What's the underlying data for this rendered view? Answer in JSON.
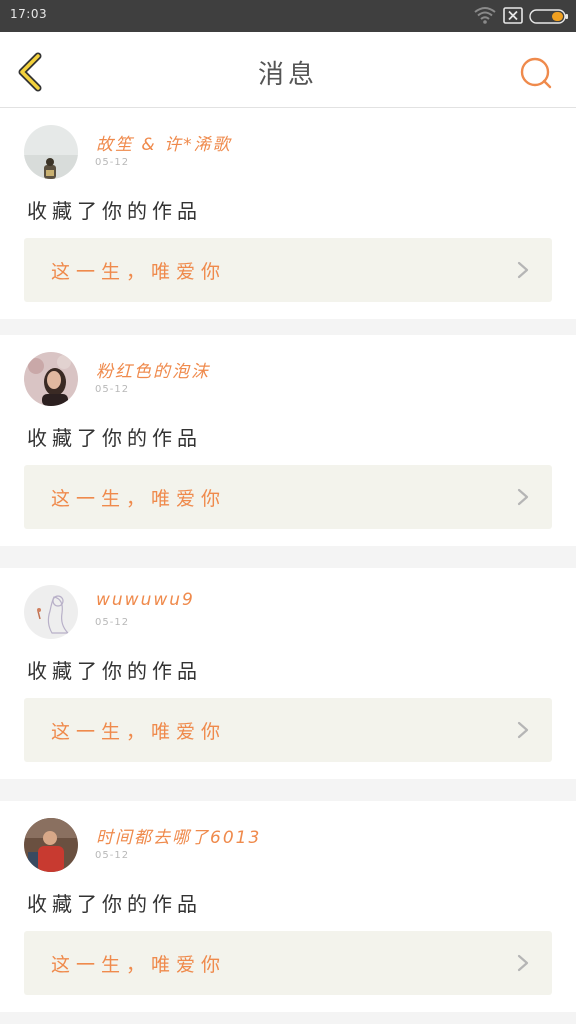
{
  "status_bar": {
    "time": "17:03",
    "icons": [
      "wifi-icon",
      "no-sim-icon",
      "battery-icon"
    ],
    "battery_color": "#f0a020"
  },
  "header": {
    "title": "消息",
    "back_icon": "chevron-left-icon",
    "search_icon": "search-icon",
    "accent_color": "#ef8a4c"
  },
  "notifications": [
    {
      "username": "故笙 & 许*浠歌",
      "date": "05-12",
      "action": "收藏了你的作品",
      "work_title": "这一生，唯爱你"
    },
    {
      "username": "粉红色的泡沫",
      "date": "05-12",
      "action": "收藏了你的作品",
      "work_title": "这一生，唯爱你"
    },
    {
      "username": "wuwuwu9",
      "date": "05-12",
      "action": "收藏了你的作品",
      "work_title": "这一生，唯爱你"
    },
    {
      "username": "时间都去哪了6013",
      "date": "05-12",
      "action": "收藏了你的作品",
      "work_title": "这一生，唯爱你"
    }
  ]
}
